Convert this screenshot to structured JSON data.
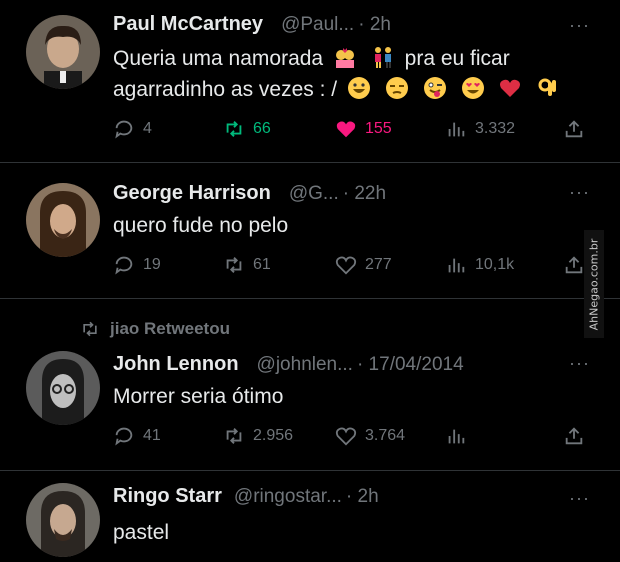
{
  "tweets": [
    {
      "name": "Paul McCartney",
      "handle": "@Paul...",
      "time": "· 2h",
      "text_line1": "Queria uma namorada",
      "text_line1b": "pra eu ficar",
      "text_line2": "agarradinho as vezes : /",
      "emojis_line1": [
        "couple-with-heart-emoji",
        "couple-holding-hands-emoji"
      ],
      "emojis_line2": [
        "grinning-face-emoji",
        "unamused-face-emoji",
        "winking-tongue-emoji",
        "heart-eyes-emoji",
        "red-heart-emoji",
        "ok-hand-emoji"
      ],
      "stats": {
        "replies": "4",
        "retweets": "66",
        "likes": "155",
        "views": "3.332"
      }
    },
    {
      "name": "George Harrison",
      "handle": "@G...",
      "time": "· 22h",
      "text": "quero fude no pelo",
      "stats": {
        "replies": "19",
        "retweets": "61",
        "likes": "277",
        "views": "10,1k"
      }
    },
    {
      "retweeted_by": "jiao Retweetou",
      "name": "John Lennon",
      "handle": "@johnlen...",
      "time": "· 17/04/2014",
      "text": "Morrer seria ótimo",
      "stats": {
        "replies": "41",
        "retweets": "2.956",
        "likes": "3.764"
      }
    },
    {
      "name": "Ringo Starr",
      "handle": "@ringostar...",
      "time": "· 2h",
      "text": "pastel"
    }
  ],
  "more_label": "···",
  "watermark": "AhNegao.com.br",
  "colors": {
    "background": "#000000",
    "muted": "#71767b",
    "retweet": "#00ba7c",
    "like": "#f91880",
    "text": "#e7e9ea"
  }
}
